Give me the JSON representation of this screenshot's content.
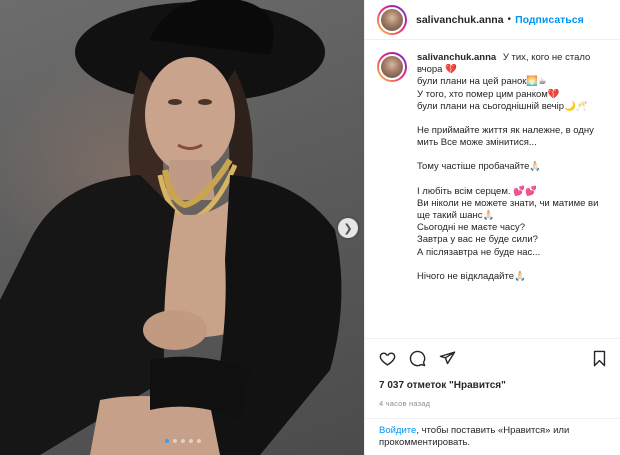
{
  "post": {
    "username": "salivanchuk.anna",
    "separator": "•",
    "follow_label": "Подписаться",
    "more_label": "•••",
    "caption_lines": [
      "У тих, кого не стало вчора 💔",
      "були плани на цей ранок🌅☕",
      "У того, хто помер цим ранком💔",
      "були плани на сьогоднішній вечір🌙🥂",
      "",
      "Не приймайте життя як належне, в одну мить Все може змінитися...",
      "",
      "Тому частіше пробачайте🙏🏻",
      "",
      "І любіть всім серцем. 💕💕",
      "Ви ніколи не можете знати, чи матиме ви ще такий шанс🙏🏻",
      "Сьогодні не маєте часу?",
      "Завтра у вас не буде сили?",
      "А післязавтра не буде нас...",
      "",
      "Нічого не відкладайте🙏🏻"
    ],
    "likes_text": "7 037 отметок \"Нравится\"",
    "time_text": "4 часов назад",
    "login_link": "Войдите",
    "login_rest": ", чтобы поставить «Нравится» или прокомментировать."
  },
  "carousel": {
    "next_icon": "chevron-right-icon",
    "slide_count": 5,
    "active_slide": 1
  },
  "colors": {
    "accent": "#0095f6",
    "active_dot": "#3d9bf0",
    "text": "#262626",
    "muted": "#8e8e8e"
  }
}
